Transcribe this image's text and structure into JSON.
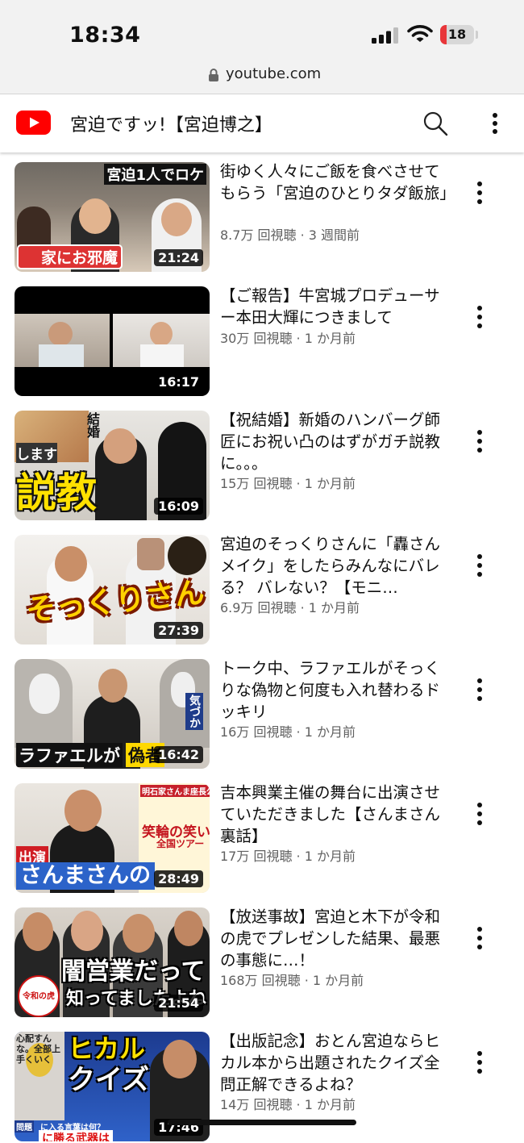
{
  "status_bar": {
    "time": "18:34",
    "battery": "18",
    "battery_level": 0.18,
    "battery_color": "#e8363a"
  },
  "browser": {
    "url": "youtube.com"
  },
  "header": {
    "channel_title": "宮迫ですッ!【宮迫博之】",
    "brand_color": "#ff0000",
    "search_icon": "search-icon",
    "menu_icon": "more-vert-icon"
  },
  "videos": [
    {
      "title": "街ゆく人々にご飯を食べさせてもらう「宮迫のひとりタダ飯旅」",
      "meta": "8.7万 回視聴 · 3 週間前",
      "duration": "21:24",
      "thumb_texts": [
        "宮迫1人でロケ",
        "家にお邪魔"
      ]
    },
    {
      "title": "【ご報告】牛宮城プロデューサー本田大輝につきまして",
      "meta": "30万 回視聴 · 1 か月前",
      "duration": "16:17",
      "thumb_texts": []
    },
    {
      "title": "【祝結婚】新婚のハンバーグ師匠にお祝い凸のはずがガチ説教に。。。",
      "meta": "15万 回視聴 · 1 か月前",
      "duration": "16:09",
      "thumb_texts": [
        "結婚",
        "します",
        "説教"
      ]
    },
    {
      "title": "宮迫のそっくりさんに「轟さんメイク」をしたらみんなにバレる？ バレない？【モニ…",
      "meta": "6.9万 回視聴 · 1 か月前",
      "duration": "27:39",
      "thumb_texts": [
        "そっくりさん"
      ]
    },
    {
      "title": "トーク中、ラファエルがそっくりな偽物と何度も入れ替わるドッキリ",
      "meta": "16万 回視聴 · 1 か月前",
      "duration": "16:42",
      "thumb_texts": [
        "ラファエルが",
        "偽者",
        "気づか"
      ]
    },
    {
      "title": "吉本興業主催の舞台に出演させていただきました【さんまさん裏話】",
      "meta": "17万 回視聴 · 1 か月前",
      "duration": "28:49",
      "thumb_texts": [
        "明石家さんま座長公演",
        "笑輪の笑い",
        "全国ツアー",
        "出演",
        "さんまさんの"
      ]
    },
    {
      "title": "【放送事故】宮迫と木下が令和の虎でプレゼンした結果、最悪の事態に…！",
      "meta": "168万 回視聴 · 1 か月前",
      "duration": "21:54",
      "thumb_texts": [
        "闇営業だって",
        "知ってましたよね",
        "令和の虎"
      ]
    },
    {
      "title": "【出版記念】おとん宮迫ならヒカル本から出題されたクイズ全問正解できるよね？",
      "meta": "14万 回視聴 · 1 か月前",
      "duration": "17:46",
      "thumb_texts": [
        "ヒカル",
        "クイズ",
        "心配すんな。全部上手くいく",
        "問題",
        "に入る言葉は何？",
        "に勝る武器は"
      ]
    }
  ]
}
